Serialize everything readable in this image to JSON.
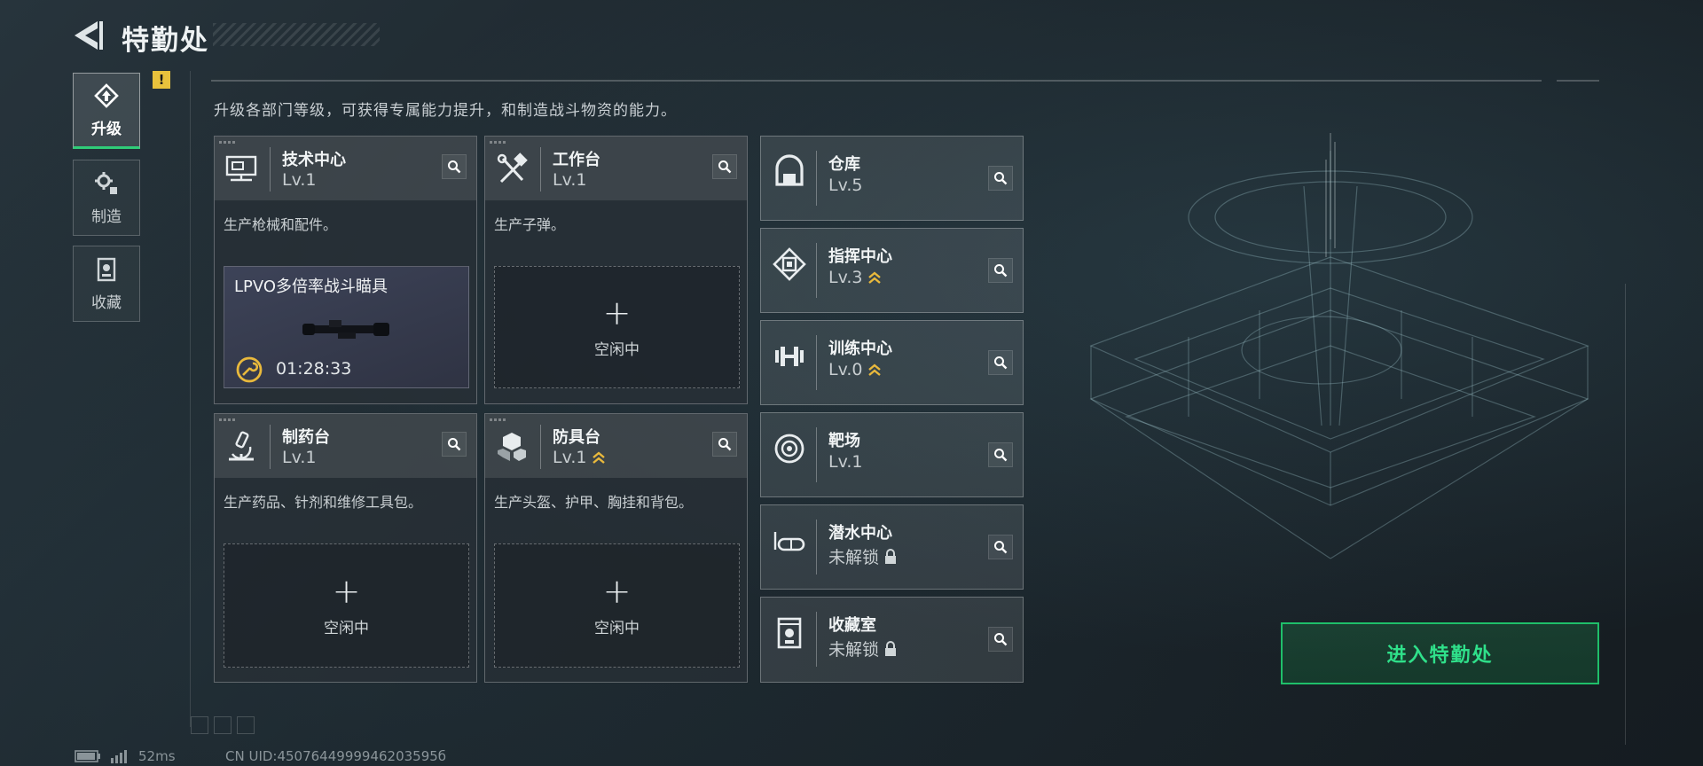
{
  "header": {
    "title": "特勤处"
  },
  "nav": {
    "items": [
      {
        "label": "升级",
        "active": true,
        "icon": "upgrade-icon",
        "alert": "!"
      },
      {
        "label": "制造",
        "active": false,
        "icon": "gear-icon"
      },
      {
        "label": "收藏",
        "active": false,
        "icon": "collection-icon"
      }
    ]
  },
  "description": "升级各部门等级，可获得专属能力提升，和制造战斗物资的能力。",
  "departments": [
    {
      "name": "技术中心",
      "level": "Lv.1",
      "desc": "生产枪械和配件。",
      "icon": "monitor-icon",
      "production": {
        "item": "LPVO多倍率战斗瞄具",
        "timer": "01:28:33"
      }
    },
    {
      "name": "工作台",
      "level": "Lv.1",
      "desc": "生产子弹。",
      "icon": "tools-icon",
      "slot_plus": "+",
      "slot_status": "空闲中"
    },
    {
      "name": "制药台",
      "level": "Lv.1",
      "desc": "生产药品、针剂和维修工具包。",
      "icon": "microscope-icon",
      "slot_plus": "+",
      "slot_status": "空闲中"
    },
    {
      "name": "防具台",
      "level": "Lv.1",
      "desc": "生产头盔、护甲、胸挂和背包。",
      "icon": "armor-icon",
      "upgradable": true,
      "slot_plus": "+",
      "slot_status": "空闲中"
    }
  ],
  "facilities": [
    {
      "name": "仓库",
      "level": "Lv.5",
      "icon": "warehouse-icon"
    },
    {
      "name": "指挥中心",
      "level": "Lv.3",
      "icon": "command-icon",
      "upgradable": true
    },
    {
      "name": "训练中心",
      "level": "Lv.0",
      "icon": "dumbbell-icon",
      "upgradable": true
    },
    {
      "name": "靶场",
      "level": "Lv.1",
      "icon": "target-icon"
    },
    {
      "name": "潜水中心",
      "level": "未解锁",
      "icon": "diving-mask-icon",
      "locked": true
    },
    {
      "name": "收藏室",
      "level": "未解锁",
      "icon": "trophy-case-icon",
      "locked": true
    }
  ],
  "enter_button": "进入特勤处",
  "status": {
    "latency": "52ms",
    "uid": "CN UID:4507644999946203595б"
  },
  "colors": {
    "accent_green": "#2fe08a",
    "upgrade_gold": "#e9b93c",
    "alert_yellow": "#e9c23c"
  }
}
